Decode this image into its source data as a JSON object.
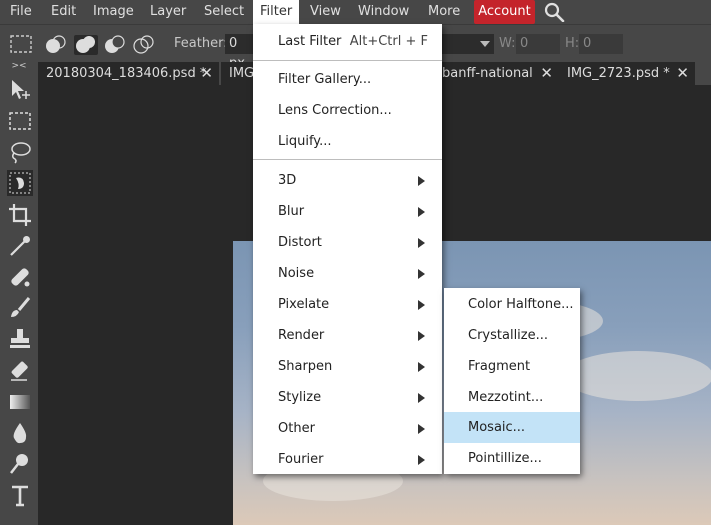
{
  "menubar": {
    "items": [
      "File",
      "Edit",
      "Image",
      "Layer",
      "Select",
      "Filter",
      "View",
      "Window",
      "More"
    ],
    "account": "Account",
    "account_color": "#c4242b"
  },
  "options": {
    "feather_label": "Feather:",
    "feather_value": "0 px",
    "w_label": "W:",
    "w_value": "0",
    "h_label": "H:",
    "h_value": "0"
  },
  "toolbar": {
    "collapse": "><",
    "tools": [
      "move-tool-icon",
      "rectangle-select-icon",
      "lasso-icon",
      "quick-select-icon",
      "crop-icon",
      "eyedropper-icon",
      "healing-brush-icon",
      "brush-icon",
      "clone-stamp-icon",
      "eraser-icon",
      "gradient-icon",
      "blur-drop-icon",
      "dodge-icon",
      "type-icon"
    ]
  },
  "tabs": [
    {
      "label": "20180304_183406.psd *"
    },
    {
      "label": "IMG_"
    },
    {
      "label": "banff-national"
    },
    {
      "label": "IMG_2723.psd *"
    }
  ],
  "filter_menu": {
    "last_filter": "Last Filter",
    "last_filter_shortcut": "Alt+Ctrl + F",
    "group1": [
      "Filter Gallery...",
      "Lens Correction...",
      "Liquify..."
    ],
    "submenus": [
      "3D",
      "Blur",
      "Distort",
      "Noise",
      "Pixelate",
      "Render",
      "Sharpen",
      "Stylize",
      "Other",
      "Fourier"
    ]
  },
  "pixelate_submenu": {
    "items": [
      "Color Halftone...",
      "Crystallize...",
      "Fragment",
      "Mezzotint...",
      "Mosaic...",
      "Pointillize..."
    ],
    "highlighted": "Mosaic...",
    "highlight_color": "#c3e3f7"
  }
}
